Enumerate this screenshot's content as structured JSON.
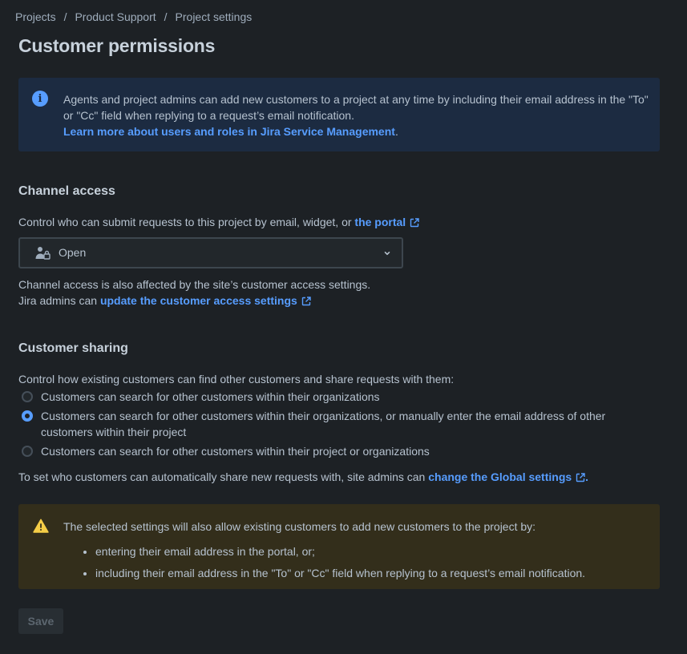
{
  "breadcrumb": {
    "items": [
      "Projects",
      "Product Support",
      "Project settings"
    ],
    "separator": "/"
  },
  "page_title": "Customer permissions",
  "info_panel": {
    "icon": "info-icon",
    "text": "Agents and project admins can add new customers to a project at any time by including their email address in the \"To\" or \"Cc\" field when replying to a request’s email notification.",
    "link": "Learn more about users and roles in Jira Service Management",
    "link_suffix": "."
  },
  "channel_access": {
    "heading": "Channel access",
    "description": "Control who can submit requests to this project by email, widget, or ",
    "portal_link": "the portal",
    "select": {
      "icon": "people-lock-icon",
      "value": "Open"
    },
    "note_line1": "Channel access is also affected by the site’s customer access settings.",
    "note_line2_prefix": "Jira admins can ",
    "note_link": "update the customer access settings"
  },
  "customer_sharing": {
    "heading": "Customer sharing",
    "description": "Control how existing customers can find other customers and share requests with them:",
    "options": [
      {
        "line1": "Customers can search for other customers within their organizations",
        "line2": "",
        "checked": false
      },
      {
        "line1": "Customers can search for other customers within their organizations, or manually enter the email address of other",
        "line2": "customers within their project",
        "checked": true
      },
      {
        "line1": "Customers can search for other customers within their project or organizations",
        "line2": "",
        "checked": false
      }
    ],
    "global_prefix": "To set who customers can automatically share new requests with, site admins can ",
    "global_link": "change the Global settings",
    "global_suffix": "."
  },
  "warning_panel": {
    "icon": "warning-icon",
    "text": "The selected settings will also allow existing customers to add new customers to the project by:",
    "items": [
      "entering their email address in the portal, or;",
      "including their email address in the \"To\" or \"Cc\" field when replying to a request’s email notification."
    ]
  },
  "save_label": "Save",
  "colors": {
    "background": "#1d2125",
    "link": "#579dff",
    "info_bg": "#1c2b41",
    "warning_bg": "#332e1b",
    "warning_icon": "#f5cd47"
  }
}
